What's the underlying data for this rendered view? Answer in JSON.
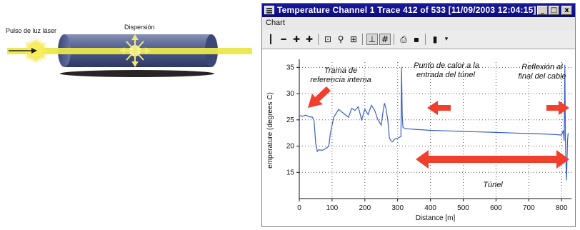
{
  "illustration": {
    "pulse_label": "Pulso de luz láser",
    "scatter_label": "Dispersión"
  },
  "window": {
    "title": "Temperature Channel 1 Trace 412 of 533 [11/09/2003 12:04:15]",
    "controls": {
      "minimize": "_",
      "maximize": "□",
      "close": "x"
    },
    "menu": {
      "chart": "Chart"
    },
    "toolbar": [
      "line-tool-icon",
      "hline-tool-icon",
      "cursor1-icon",
      "cursor2-icon",
      "fit-icon",
      "zoom-icon",
      "zoom-window-icon",
      "axes-icon",
      "grid-icon",
      "print-icon",
      "save-icon",
      "export-icon",
      "dropdown-icon"
    ]
  },
  "chart_data": {
    "type": "line",
    "xlabel": "Distance [m]",
    "ylabel": "emperature (degrees C)",
    "xlim": [
      0,
      830
    ],
    "ylim": [
      10,
      36
    ],
    "xticks": [
      0,
      100,
      200,
      300,
      400,
      500,
      600,
      700,
      800
    ],
    "yticks": [
      15,
      20,
      25,
      30,
      35
    ],
    "grid": "dotted",
    "line_color": "#3a5fc8",
    "arrow_color": "#f0402d",
    "series": [
      {
        "x": [
          0,
          10,
          20,
          30,
          40,
          45,
          50,
          55,
          60,
          70,
          80,
          90,
          95,
          100,
          105,
          110,
          120,
          130,
          140,
          150,
          160,
          170,
          180,
          190,
          200,
          210,
          220,
          230,
          240,
          250,
          255,
          260,
          265,
          270,
          275,
          280,
          285,
          290,
          300,
          310,
          312,
          314,
          316,
          320,
          330,
          350,
          400,
          450,
          500,
          550,
          600,
          650,
          700,
          750,
          780,
          800,
          805,
          808,
          810,
          812,
          815,
          818,
          820
        ],
        "y": [
          25.8,
          25.7,
          25.9,
          25.6,
          25.5,
          24.8,
          20.5,
          19.0,
          19.3,
          19.2,
          19.5,
          20.0,
          22.5,
          24.0,
          25.5,
          26.0,
          27.0,
          26.5,
          26.0,
          25.5,
          27.2,
          26.8,
          27.5,
          25.0,
          27.0,
          26.0,
          27.8,
          26.8,
          25.0,
          24.0,
          26.5,
          28.2,
          27.0,
          25.0,
          21.5,
          21.0,
          20.8,
          21.3,
          21.5,
          21.8,
          35.0,
          26.0,
          23.6,
          23.4,
          23.3,
          23.2,
          23.0,
          22.9,
          22.8,
          22.7,
          22.6,
          22.5,
          22.4,
          22.3,
          22.2,
          22.1,
          23.0,
          21.0,
          35.5,
          20.0,
          13.5,
          21.0,
          22.5
        ]
      }
    ],
    "annotations": [
      {
        "text": "Trama de"
      },
      {
        "text": "referencia interna"
      },
      {
        "text": "Punto de calor a la"
      },
      {
        "text": "entrada del túnel"
      },
      {
        "text": "Reflexión al"
      },
      {
        "text": "final del cable"
      },
      {
        "text": "Túnel"
      }
    ]
  }
}
